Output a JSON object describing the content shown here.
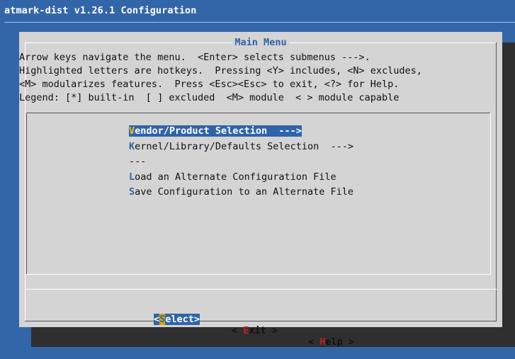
{
  "backtitle": "atmark-dist v1.26.1 Configuration",
  "dialog": {
    "title": "Main Menu",
    "help_lines": [
      "Arrow keys navigate the menu.  <Enter> selects submenus --->.",
      "Highlighted letters are hotkeys.  Pressing <Y> includes, <N> excludes,",
      "<M> modularizes features.  Press <Esc><Esc> to exit, <?> for Help.",
      "Legend: [*] built-in  [ ] excluded  <M> module  < > module capable"
    ]
  },
  "menu": {
    "items": [
      {
        "hotkey": "V",
        "rest": "endor/Product Selection  --->",
        "selected": true
      },
      {
        "hotkey": "K",
        "rest": "ernel/Library/Defaults Selection  --->",
        "selected": false
      },
      {
        "hotkey": "",
        "rest": "---",
        "selected": false
      },
      {
        "hotkey": "L",
        "rest": "oad an Alternate Configuration File",
        "selected": false
      },
      {
        "hotkey": "S",
        "rest": "ave Configuration to an Alternate File",
        "selected": false
      }
    ]
  },
  "buttons": {
    "select": {
      "open": "<",
      "hotkey": "S",
      "rest": "elect",
      "close": ">"
    },
    "exit": {
      "open": "< ",
      "hotkey": "E",
      "rest": "xit",
      "close": " >"
    },
    "help": {
      "open": "< ",
      "hotkey": "H",
      "rest": "elp",
      "close": " >"
    }
  },
  "colors": {
    "background": "#3366a8",
    "dialog": "#d4d4d4",
    "highlight": "#2f64a8",
    "hotkey_selected": "#f0c020",
    "button_hotkey": "#c02020",
    "shadow": "#2f2f2f"
  }
}
